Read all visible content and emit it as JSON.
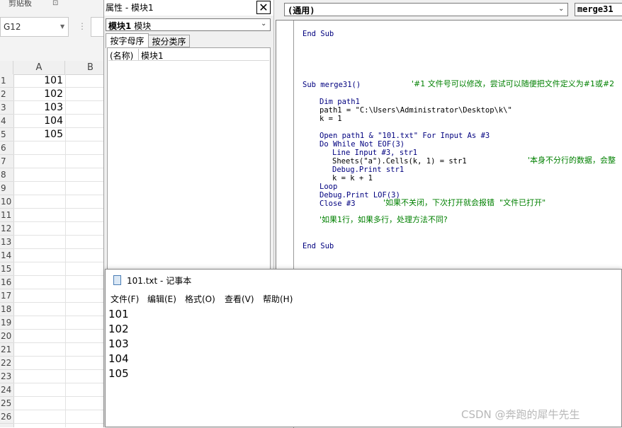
{
  "excel": {
    "clipboard_label": "剪贴板",
    "name_box": "G12",
    "columns": [
      "A",
      "B"
    ],
    "rows": [
      "1",
      "2",
      "3",
      "4",
      "5",
      "6",
      "7",
      "8",
      "9",
      "10",
      "11",
      "12",
      "13",
      "14",
      "15",
      "16",
      "17",
      "18",
      "19",
      "20",
      "21",
      "22",
      "23",
      "24",
      "25",
      "26"
    ],
    "cells_a": [
      "101",
      "102",
      "103",
      "104",
      "105"
    ]
  },
  "properties": {
    "title": "属性 - 模块1",
    "object_name": "模块1",
    "object_type": "模块",
    "tab_alpha": "按字母序",
    "tab_category": "按分类序",
    "row_name": "(名称)",
    "row_value": "模块1"
  },
  "code": {
    "object_combo": "(通用)",
    "proc_combo": "merge31",
    "end_sub_1": "End Sub",
    "sub_decl": "Sub merge31()",
    "comment_1": "'#1 文件号可以修改，尝试可以随便把文件定义为#1或#2",
    "dim": "Dim path1",
    "path_assign": "path1 = \"C:\\Users\\Administrator\\Desktop\\k\\\"",
    "k_init": "k = 1",
    "open_stmt": "Open path1 & \"101.txt\" For Input As #3",
    "do_while": "Do While Not EOF(3)",
    "line_input": "Line Input #3, str1",
    "sheets_assign": "Sheets(\"a\").Cells(k, 1) = str1",
    "comment_2": "'本身不分行的数据，会整",
    "debug_print_str": "Debug.Print str1",
    "k_inc": "k = k + 1",
    "loop": "Loop",
    "debug_print_lof": "Debug.Print LOF(3)",
    "close_stmt": "Close #3",
    "comment_3": "'如果不关闭，下次打开就会报错  \"文件已打开\"",
    "comment_4": "'如果1行，如果多行，处理方法不同?",
    "end_sub_2": "End Sub"
  },
  "notepad": {
    "title": "101.txt - 记事本",
    "menu": [
      "文件(F)",
      "编辑(E)",
      "格式(O)",
      "查看(V)",
      "帮助(H)"
    ],
    "lines": [
      "101",
      "102",
      "103",
      "104",
      "105"
    ]
  },
  "watermark": "CSDN @奔跑的犀牛先生"
}
